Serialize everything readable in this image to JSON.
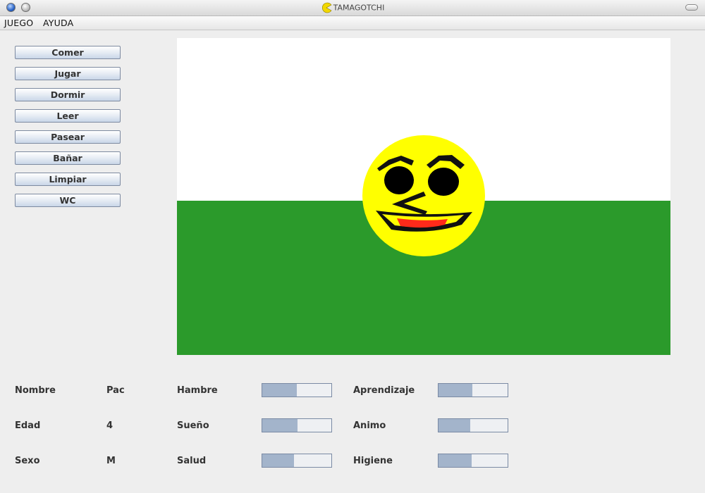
{
  "window": {
    "title": "TAMAGOTCHI",
    "app_icon": "pacman-icon"
  },
  "menu": {
    "items": [
      "JUEGO",
      "AYUDA"
    ]
  },
  "actions": [
    "Comer",
    "Jugar",
    "Dormir",
    "Leer",
    "Pasear",
    "Bañar",
    "Limpiar",
    "WC"
  ],
  "scene": {
    "sky_color": "#ffffff",
    "grass_color": "#2b9a2b",
    "pet_color": "#ffff00"
  },
  "stats": {
    "nombre": {
      "label": "Nombre",
      "value": "Pac"
    },
    "edad": {
      "label": "Edad",
      "value": "4"
    },
    "sexo": {
      "label": "Sexo",
      "value": "M"
    },
    "hambre": {
      "label": "Hambre",
      "level": 0.5
    },
    "sueno": {
      "label": "Sueño",
      "level": 0.51
    },
    "salud": {
      "label": "Salud",
      "level": 0.46
    },
    "aprendizaje": {
      "label": "Aprendizaje",
      "level": 0.49
    },
    "animo": {
      "label": "Animo",
      "level": 0.46
    },
    "higiene": {
      "label": "Higiene",
      "level": 0.48
    }
  }
}
